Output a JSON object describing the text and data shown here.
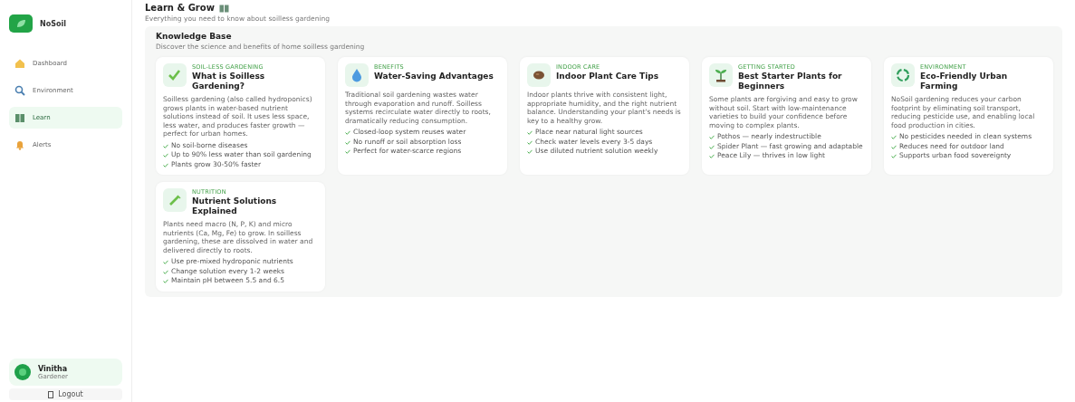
{
  "sidebar": {
    "brand": "NoSoil",
    "items": [
      {
        "label": "Dashboard",
        "selected": false
      },
      {
        "label": "Environment",
        "selected": false
      },
      {
        "label": "Learn",
        "selected": true
      },
      {
        "label": "Alerts",
        "selected": false
      }
    ],
    "user": {
      "name": "Vinitha",
      "role": "Gardener"
    },
    "logout": "Logout"
  },
  "header": {
    "title": "Learn & Grow",
    "subtitle": "Everything you need to know about soilless gardening"
  },
  "section": {
    "title": "Knowledge Base",
    "subtitle": "Discover the science and benefits of home soilless gardening"
  },
  "cards": [
    {
      "tag": "SOIL-LESS GARDENING",
      "title": "What is Soilless Gardening?",
      "body": "Soilless gardening (also called hydroponics) grows plants in water-based nutrient solutions instead of soil. It uses less space, less water, and produces faster growth — perfect for urban homes.",
      "points": [
        "No soil-borne diseases",
        "Up to 90% less water than soil gardening",
        "Plants grow 30-50% faster"
      ]
    },
    {
      "tag": "BENEFITS",
      "title": "Water-Saving Advantages",
      "body": "Traditional soil gardening wastes water through evaporation and runoff. Soilless systems recirculate water directly to roots, dramatically reducing consumption.",
      "points": [
        "Closed-loop system reuses water",
        "No runoff or soil absorption loss",
        "Perfect for water-scarce regions"
      ]
    },
    {
      "tag": "INDOOR CARE",
      "title": "Indoor Plant Care Tips",
      "body": "Indoor plants thrive with consistent light, appropriate humidity, and the right nutrient balance. Understanding your plant's needs is key to a healthy grow.",
      "points": [
        "Place near natural light sources",
        "Check water levels every 3-5 days",
        "Use diluted nutrient solution weekly"
      ]
    },
    {
      "tag": "GETTING STARTED",
      "title": "Best Starter Plants for Beginners",
      "body": "Some plants are forgiving and easy to grow without soil. Start with low-maintenance varieties to build your confidence before moving to complex plants.",
      "points": [
        "Pothos — nearly indestructible",
        "Spider Plant — fast growing and adaptable",
        "Peace Lily — thrives in low light"
      ]
    },
    {
      "tag": "ENVIRONMENT",
      "title": "Eco-Friendly Urban Farming",
      "body": "NoSoil gardening reduces your carbon footprint by eliminating soil transport, reducing pesticide use, and enabling local food production in cities.",
      "points": [
        "No pesticides needed in clean systems",
        "Reduces need for outdoor land",
        "Supports urban food sovereignty"
      ]
    },
    {
      "tag": "NUTRITION",
      "title": "Nutrient Solutions Explained",
      "body": "Plants need macro (N, P, K) and micro nutrients (Ca, Mg, Fe) to grow. In soilless gardening, these are dissolved in water and delivered directly to roots.",
      "points": [
        "Use pre-mixed hydroponic nutrients",
        "Change solution every 1-2 weeks",
        "Maintain pH between 5.5 and 6.5"
      ]
    }
  ]
}
